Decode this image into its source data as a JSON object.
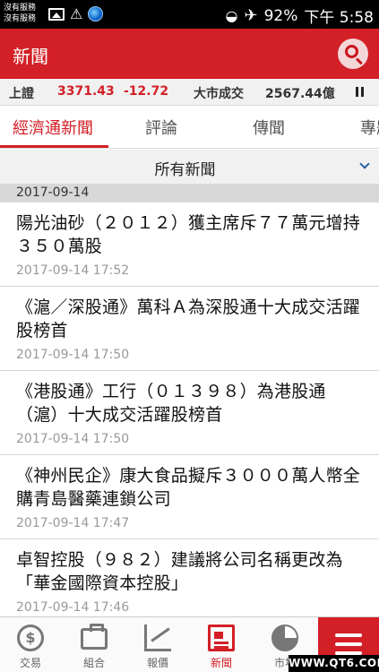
{
  "status_bar": {
    "carrier_line1": "沒有服務",
    "carrier_line2": "沒有服務",
    "battery": "92%",
    "time": "下午 5:58"
  },
  "header": {
    "title": "新聞",
    "search_icon": "search-icon"
  },
  "ticker": {
    "label1": "上證",
    "value1": "3371.43",
    "change1": "-12.72",
    "label2": "大市成交",
    "value2": "2567.44億"
  },
  "tabs": [
    {
      "label": "經濟通新聞",
      "active": true
    },
    {
      "label": "評論",
      "active": false
    },
    {
      "label": "傳聞",
      "active": false
    },
    {
      "label": "專題",
      "active": false
    }
  ],
  "filter": {
    "label": "所有新聞"
  },
  "date_header": "2017-09-14",
  "news": [
    {
      "title": "陽光油砂（２０１２）獲主席斥７７萬元增持３５０萬股",
      "time": "2017-09-14 17:52"
    },
    {
      "title": "《滬／深股通》萬科Ａ為深股通十大成交活躍股榜首",
      "time": "2017-09-14 17:50"
    },
    {
      "title": "《港股通》工行（０１３９８）為港股通（滬）十大成交活躍股榜首",
      "time": "2017-09-14 17:50"
    },
    {
      "title": "《神州民企》康大食品擬斥３０００萬人幣全購青島醫藥連鎖公司",
      "time": "2017-09-14 17:47"
    },
    {
      "title": "卓智控股（９８２）建議將公司名稱更改為「華金國際資本控股」",
      "time": "2017-09-14 17:46"
    }
  ],
  "bottom_nav": [
    {
      "label": "交易",
      "icon": "dollar-icon"
    },
    {
      "label": "組合",
      "icon": "briefcase-icon"
    },
    {
      "label": "報價",
      "icon": "chart-icon"
    },
    {
      "label": "新聞",
      "icon": "news-icon",
      "active": true
    },
    {
      "label": "市場",
      "icon": "pie-chart-icon"
    }
  ],
  "colors": {
    "brand_red": "#d31f26",
    "price_red": "#d31f26",
    "ticker_bg": "#f1f1f1",
    "date_bg": "#d8d8d8"
  },
  "watermark": "WWW.QT6.COM"
}
